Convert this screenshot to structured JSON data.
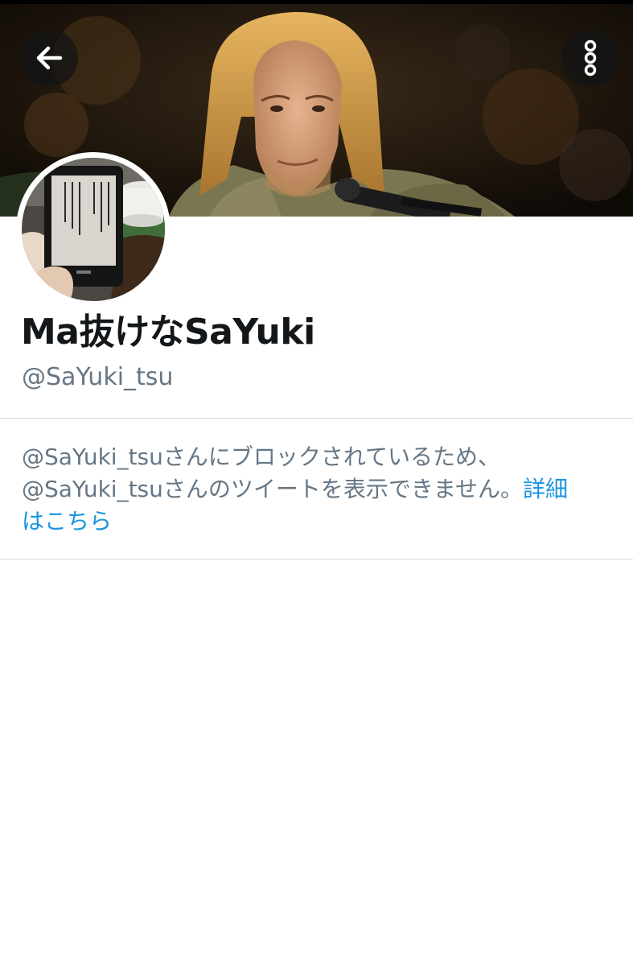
{
  "header": {
    "back_icon": "arrow-left-icon",
    "more_icon": "more-vertical-icon"
  },
  "profile": {
    "display_name": "Ma抜けなSaYuki",
    "handle": "@SaYuki_tsu"
  },
  "block_notice": {
    "line1": "@SaYuki_tsuさんにブロックされているため、",
    "line2": "@SaYuki_tsuさんのツイートを表示できません。",
    "link_part1": "詳細",
    "link_part2": "はこちら"
  },
  "colors": {
    "name": "#14171a",
    "secondary_text": "#657786",
    "link": "#1b95e0",
    "divider": "#cfd6db"
  }
}
